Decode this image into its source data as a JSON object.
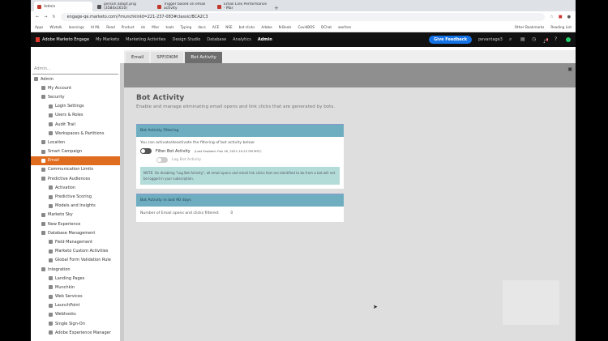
{
  "browser": {
    "tabs": [
      "Admin",
      "person adopt.png (3584x1610)",
      "Trigger based on email activity",
      "Email Link Performance - Mar"
    ],
    "url": "engage-qe.marketo.com/?munchkinId=221-237-083#classic/BCA2C3",
    "bookmarks": [
      "Apps",
      "Wiztalk",
      "learnings",
      "AI ML",
      "Read",
      "Product",
      "sls",
      "Misc",
      "tools",
      "Typing",
      "docs",
      "ACE",
      "NSE",
      "bot clicks",
      "Adobe",
      "N-Bools",
      "CovidBOS",
      "DChat",
      "warfare",
      "Other Bookmarks",
      "Reading List"
    ]
  },
  "nav": {
    "brand": "Adobe Marketo Engage",
    "items": [
      "My Marketo",
      "Marketing Activities",
      "Design Studio",
      "Database",
      "Analytics",
      "Admin"
    ],
    "feedback": "Give Feedback",
    "user": "pevantage3",
    "badge": "9"
  },
  "subtabs": [
    "Email",
    "SPF/DKIM",
    "Bot Activity"
  ],
  "sidebar": {
    "search_placeholder": "Admin...",
    "items": [
      {
        "label": "Admin",
        "lvl": 0
      },
      {
        "label": "My Account",
        "lvl": 1
      },
      {
        "label": "Security",
        "lvl": 1
      },
      {
        "label": "Login Settings",
        "lvl": 2
      },
      {
        "label": "Users & Roles",
        "lvl": 2
      },
      {
        "label": "Audit Trail",
        "lvl": 2
      },
      {
        "label": "Workspaces & Partitions",
        "lvl": 2
      },
      {
        "label": "Location",
        "lvl": 1
      },
      {
        "label": "Smart Campaign",
        "lvl": 1
      },
      {
        "label": "Email",
        "lvl": 1,
        "sel": true
      },
      {
        "label": "Communication Limits",
        "lvl": 1
      },
      {
        "label": "Predictive Audiences",
        "lvl": 1
      },
      {
        "label": "Activation",
        "lvl": 2
      },
      {
        "label": "Predictive Scoring",
        "lvl": 2
      },
      {
        "label": "Models and Insights",
        "lvl": 2
      },
      {
        "label": "Marketo Sky",
        "lvl": 1
      },
      {
        "label": "New Experience",
        "lvl": 1
      },
      {
        "label": "Database Management",
        "lvl": 1
      },
      {
        "label": "Field Management",
        "lvl": 2
      },
      {
        "label": "Marketo Custom Activities",
        "lvl": 2
      },
      {
        "label": "Global Form Validation Rule",
        "lvl": 2
      },
      {
        "label": "Integration",
        "lvl": 1
      },
      {
        "label": "Landing Pages",
        "lvl": 2
      },
      {
        "label": "Munchkin",
        "lvl": 2
      },
      {
        "label": "Web Services",
        "lvl": 2
      },
      {
        "label": "LaunchPoint",
        "lvl": 2
      },
      {
        "label": "Webhooks",
        "lvl": 2
      },
      {
        "label": "Single Sign-On",
        "lvl": 2
      },
      {
        "label": "Adobe Experience Manager",
        "lvl": 2
      }
    ]
  },
  "page": {
    "title": "Bot Activity",
    "subtitle": "Enable and manage eliminating email opens and link clicks that are generated by bots.",
    "filtering": {
      "header": "Bot Activity Filtering",
      "intro": "You can activate/deactivate the filtering of bot activity below:",
      "filter_label": "Filter Bot Activity",
      "filter_meta": "(Last Enabled: Feb 16, 2022 10:23 PM MST)",
      "log_label": "Log Bot Activity",
      "note": "NOTE: On disabling \"Log Bot Activity\", all email opens and email link clicks that are identified to be from a bot will not be logged in your subscription."
    },
    "stats": {
      "header": "Bot Activity in last 90 days",
      "label": "Number of Email opens and clicks filtered:",
      "value": "0"
    }
  }
}
